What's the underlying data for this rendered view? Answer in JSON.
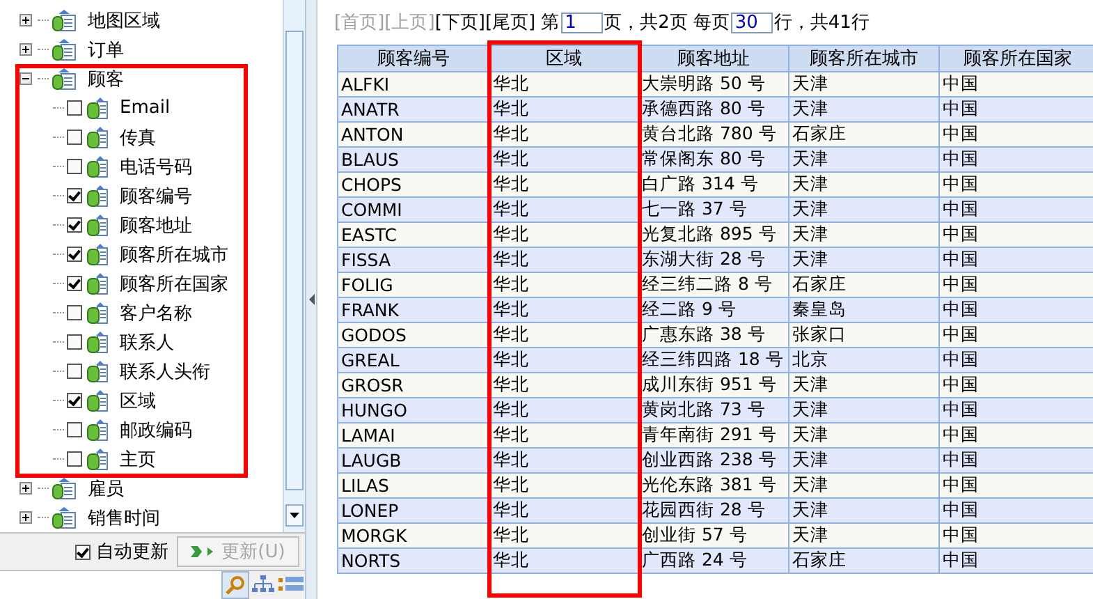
{
  "tree": {
    "nodes": [
      {
        "label": "地图区域",
        "expanded": false,
        "highlighted": false
      },
      {
        "label": "订单",
        "expanded": false,
        "highlighted": false
      },
      {
        "label": "顾客",
        "expanded": true,
        "highlighted": true,
        "children": [
          {
            "label": "Email",
            "checked": false
          },
          {
            "label": "传真",
            "checked": false
          },
          {
            "label": "电话号码",
            "checked": false
          },
          {
            "label": "顾客编号",
            "checked": true
          },
          {
            "label": "顾客地址",
            "checked": true
          },
          {
            "label": "顾客所在城市",
            "checked": true
          },
          {
            "label": "顾客所在国家",
            "checked": true
          },
          {
            "label": "客户名称",
            "checked": false
          },
          {
            "label": "联系人",
            "checked": false
          },
          {
            "label": "联系人头衔",
            "checked": false
          },
          {
            "label": "区域",
            "checked": true
          },
          {
            "label": "邮政编码",
            "checked": false
          },
          {
            "label": "主页",
            "checked": false
          }
        ]
      },
      {
        "label": "雇员",
        "expanded": false,
        "highlighted": false
      },
      {
        "label": "销售时间",
        "expanded": false,
        "highlighted": false
      }
    ]
  },
  "auto_update": {
    "label": "自动更新",
    "checked": true
  },
  "update_button": {
    "label": "更新(U)",
    "disabled": true
  },
  "pager": {
    "links": [
      {
        "label": "[首页]",
        "disabled": true
      },
      {
        "label": "[上页]",
        "disabled": true
      },
      {
        "label": "[下页]",
        "disabled": false
      },
      {
        "label": "[尾页]",
        "disabled": false
      }
    ],
    "page_prefix": "第",
    "page_value": "1",
    "page_suffix": "页，共2页",
    "rows_prefix": "每页",
    "rows_value": "30",
    "rows_suffix": "行，共41行"
  },
  "table": {
    "columns": [
      {
        "label": "顾客编号",
        "highlighted": false
      },
      {
        "label": "区域",
        "highlighted": true
      },
      {
        "label": "顾客地址",
        "highlighted": false
      },
      {
        "label": "顾客所在城市",
        "highlighted": false
      },
      {
        "label": "顾客所在国家",
        "highlighted": false
      }
    ],
    "rows": [
      [
        "ALFKI",
        "华北",
        "大崇明路 50 号",
        "天津",
        "中国"
      ],
      [
        "ANATR",
        "华北",
        "承德西路 80 号",
        "天津",
        "中国"
      ],
      [
        "ANTON",
        "华北",
        "黄台北路 780 号",
        "石家庄",
        "中国"
      ],
      [
        "BLAUS",
        "华北",
        "常保阁东 80 号",
        "天津",
        "中国"
      ],
      [
        "CHOPS",
        "华北",
        "白广路 314 号",
        "天津",
        "中国"
      ],
      [
        "COMMI",
        "华北",
        "七一路 37 号",
        "天津",
        "中国"
      ],
      [
        "EASTC",
        "华北",
        "光复北路 895 号",
        "天津",
        "中国"
      ],
      [
        "FISSA",
        "华北",
        "东湖大街 28 号",
        "天津",
        "中国"
      ],
      [
        "FOLIG",
        "华北",
        "经三纬二路 8 号",
        "石家庄",
        "中国"
      ],
      [
        "FRANK",
        "华北",
        "经二路 9 号",
        "秦皇岛",
        "中国"
      ],
      [
        "GODOS",
        "华北",
        "广惠东路 38 号",
        "张家口",
        "中国"
      ],
      [
        "GREAL",
        "华北",
        "经三纬四路 18 号",
        "北京",
        "中国"
      ],
      [
        "GROSR",
        "华北",
        "成川东街 951 号",
        "天津",
        "中国"
      ],
      [
        "HUNGO",
        "华北",
        "黄岗北路 73 号",
        "天津",
        "中国"
      ],
      [
        "LAMAI",
        "华北",
        "青年南街 291 号",
        "天津",
        "中国"
      ],
      [
        "LAUGB",
        "华北",
        "创业西路 238 号",
        "天津",
        "中国"
      ],
      [
        "LILAS",
        "华北",
        "光伦东路 381 号",
        "天津",
        "中国"
      ],
      [
        "LONEP",
        "华北",
        "花园西街 28 号",
        "天津",
        "中国"
      ],
      [
        "MORGK",
        "华北",
        "创业街 57 号",
        "天津",
        "中国"
      ],
      [
        "NORTS",
        "华北",
        "广西路 24 号",
        "石家庄",
        "中国"
      ]
    ]
  }
}
